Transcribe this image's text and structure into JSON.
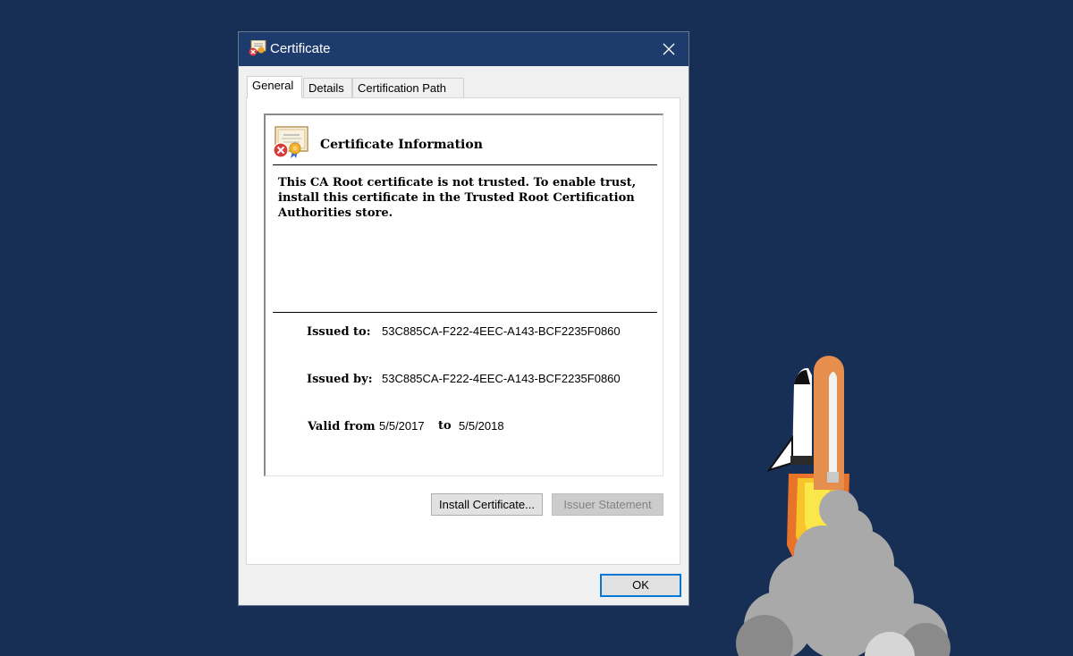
{
  "window": {
    "title": "Certificate",
    "close_glyph": "✕",
    "title_icon": "certificate-error-icon"
  },
  "tabs": [
    {
      "label": "General",
      "active": true
    },
    {
      "label": "Details",
      "active": false
    },
    {
      "label": "Certification Path",
      "active": false
    }
  ],
  "info": {
    "title": "Certificate Information",
    "warning_line1": "This CA Root certificate is not trusted. To enable trust,",
    "warning_line2": "install this certificate in the Trusted Root Certification",
    "warning_line3": "Authorities store.",
    "issued_to_label": "Issued to:",
    "issued_to_value": "53C885CA-F222-4EEC-A143-BCF2235F0860",
    "issued_by_label": "Issued by:",
    "issued_by_value": "53C885CA-F222-4EEC-A143-BCF2235F0860",
    "valid_from_label": "Valid from",
    "valid_from_value": "5/5/2017",
    "valid_to_label": "to",
    "valid_to_value": "5/5/2018"
  },
  "buttons": {
    "install": "Install Certificate...",
    "issuer": "Issuer Statement",
    "ok": "OK"
  },
  "colors": {
    "desktop_bg": "#172e55",
    "titlebar": "#1e3b6e",
    "focus_border": "#0078d7"
  }
}
